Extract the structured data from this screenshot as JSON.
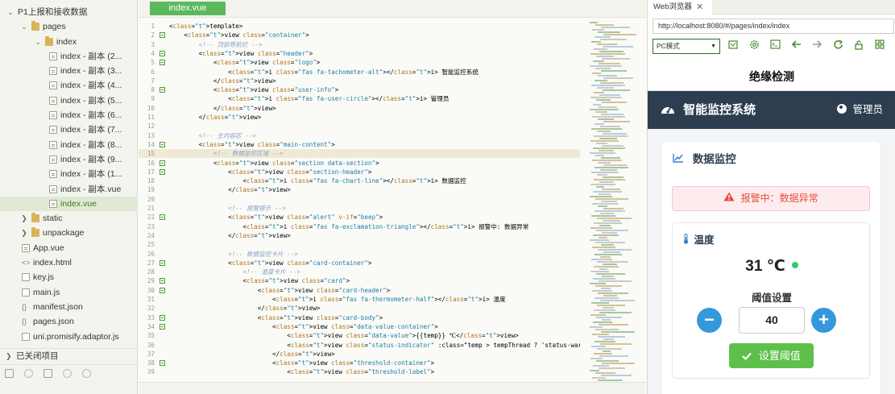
{
  "sidebar": {
    "items": [
      {
        "label": "P1上报和接收数据",
        "type": "project",
        "expanded": true
      },
      {
        "label": "pages",
        "type": "folder",
        "expanded": true
      },
      {
        "label": "index",
        "type": "folder",
        "expanded": true
      },
      {
        "label": "index - 副本 (2...",
        "type": "vue"
      },
      {
        "label": "index - 副本 (3...",
        "type": "vue"
      },
      {
        "label": "index - 副本 (4...",
        "type": "vue"
      },
      {
        "label": "index - 副本 (5...",
        "type": "vue"
      },
      {
        "label": "index - 副本 (6...",
        "type": "vue"
      },
      {
        "label": "index - 副本 (7...",
        "type": "vue"
      },
      {
        "label": "index - 副本 (8...",
        "type": "vue"
      },
      {
        "label": "index - 副本 (9...",
        "type": "vue"
      },
      {
        "label": "index - 副本 (1...",
        "type": "vue"
      },
      {
        "label": "index - 副本.vue",
        "type": "vue"
      },
      {
        "label": "index.vue",
        "type": "vue",
        "active": true
      },
      {
        "label": "static",
        "type": "folder",
        "expanded": false
      },
      {
        "label": "unpackage",
        "type": "folder",
        "expanded": false
      },
      {
        "label": "App.vue",
        "type": "vue"
      },
      {
        "label": "index.html",
        "type": "html"
      },
      {
        "label": "key.js",
        "type": "js"
      },
      {
        "label": "main.js",
        "type": "js"
      },
      {
        "label": "manifest.json",
        "type": "json"
      },
      {
        "label": "pages.json",
        "type": "json"
      },
      {
        "label": "uni.promisify.adaptor.js",
        "type": "js"
      }
    ],
    "closed_projects": "已关闭项目"
  },
  "editor": {
    "tab": "index.vue",
    "lines": [
      {
        "n": "1",
        "fold": false,
        "code": "<template>"
      },
      {
        "n": "2",
        "fold": true,
        "code": "    <view class=\"container\">"
      },
      {
        "n": "3",
        "fold": false,
        "code": "        <!-- 顶部导航栏 -->"
      },
      {
        "n": "4",
        "fold": true,
        "code": "        <view class=\"header\">"
      },
      {
        "n": "5",
        "fold": true,
        "code": "            <view class=\"logo\">"
      },
      {
        "n": "6",
        "fold": false,
        "code": "                <i class=\"fas fa-tachometer-alt\"></i> 智能监控系统"
      },
      {
        "n": "7",
        "fold": false,
        "code": "            </view>"
      },
      {
        "n": "8",
        "fold": true,
        "code": "            <view class=\"user-info\">"
      },
      {
        "n": "9",
        "fold": false,
        "code": "                <i class=\"fas fa-user-circle\"></i> 管理员"
      },
      {
        "n": "10",
        "fold": false,
        "code": "            </view>"
      },
      {
        "n": "11",
        "fold": false,
        "code": "        </view>"
      },
      {
        "n": "12",
        "fold": false,
        "code": ""
      },
      {
        "n": "13",
        "fold": false,
        "code": "        <!-- 主内容区 -->"
      },
      {
        "n": "14",
        "fold": true,
        "code": "        <view class=\"main-content\">"
      },
      {
        "n": "15",
        "fold": false,
        "code": "            <!-- 数据监控区域 -->",
        "current": true
      },
      {
        "n": "16",
        "fold": true,
        "code": "            <view class=\"section data-section\">"
      },
      {
        "n": "17",
        "fold": true,
        "code": "                <view class=\"section-header\">"
      },
      {
        "n": "18",
        "fold": false,
        "code": "                    <i class=\"fas fa-chart-line\"></i> 数据监控"
      },
      {
        "n": "19",
        "fold": false,
        "code": "                </view>"
      },
      {
        "n": "20",
        "fold": false,
        "code": ""
      },
      {
        "n": "21",
        "fold": false,
        "code": "                <!-- 报警提示 -->"
      },
      {
        "n": "22",
        "fold": true,
        "code": "                <view class=\"alert\" v-if=\"beep\">"
      },
      {
        "n": "23",
        "fold": false,
        "code": "                    <i class=\"fas fa-exclamation-triangle\"></i> 报警中: 数据异常"
      },
      {
        "n": "24",
        "fold": false,
        "code": "                </view>"
      },
      {
        "n": "25",
        "fold": false,
        "code": ""
      },
      {
        "n": "26",
        "fold": false,
        "code": "                <!-- 数据监控卡片 -->"
      },
      {
        "n": "27",
        "fold": true,
        "code": "                <view class=\"card-container\">"
      },
      {
        "n": "28",
        "fold": false,
        "code": "                    <!-- 温度卡片 -->"
      },
      {
        "n": "29",
        "fold": true,
        "code": "                    <view class=\"card\">"
      },
      {
        "n": "30",
        "fold": true,
        "code": "                        <view class=\"card-header\">"
      },
      {
        "n": "31",
        "fold": false,
        "code": "                            <i class=\"fas fa-thermometer-half\"></i> 温度"
      },
      {
        "n": "32",
        "fold": false,
        "code": "                        </view>"
      },
      {
        "n": "33",
        "fold": true,
        "code": "                        <view class=\"card-body\">"
      },
      {
        "n": "34",
        "fold": true,
        "code": "                            <view class=\"data-value-container\">"
      },
      {
        "n": "35",
        "fold": false,
        "code": "                                <view class=\"data-value\">{{temp}} ℃</view>"
      },
      {
        "n": "36",
        "fold": false,
        "code": "                                <view class=\"status-indicator\" :class=\"temp > tempThread ? 'status-warning' : 'status-no"
      },
      {
        "n": "37",
        "fold": false,
        "code": "                            </view>"
      },
      {
        "n": "38",
        "fold": true,
        "code": "                            <view class=\"threshold-container\">"
      },
      {
        "n": "39",
        "fold": false,
        "code": "                                <view class=\"threshold-label\">"
      }
    ]
  },
  "browser": {
    "tab_title": "Web浏览器",
    "close": "✕",
    "url": "http://localhost:8080/#/pages/index/index",
    "mode": "PC模式",
    "page": {
      "nav_title": "绝缘检测",
      "app_title": "智能监控系统",
      "user": "管理员",
      "section_title": "数据监控",
      "alert": "报警中：数据异常",
      "card_title": "温度",
      "temp_value": "31 ℃",
      "threshold_label": "阈值设置",
      "minus": "−",
      "plus": "+",
      "threshold_value": "40",
      "set_button": "设置阈值"
    }
  },
  "colors": {
    "accent_green": "#5cb85c",
    "header_dark": "#2c3e50",
    "alert_red": "#e74c3c",
    "button_blue": "#3498db",
    "set_green": "#5dc04a",
    "status_ok": "#2ecc71"
  }
}
